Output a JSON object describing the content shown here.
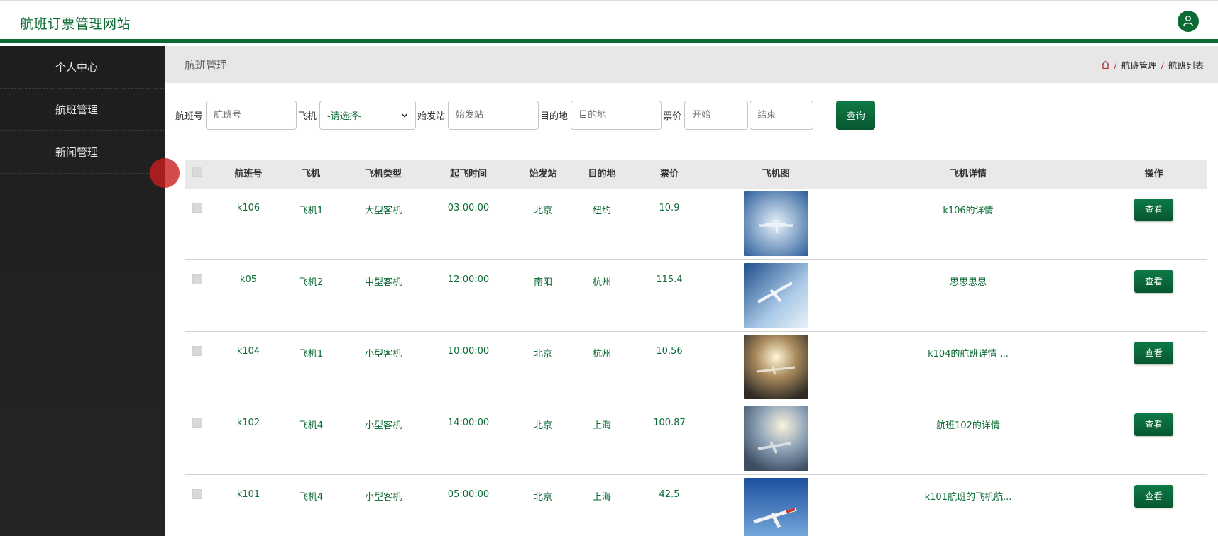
{
  "app": {
    "title": "航班订票管理网站"
  },
  "sidebar": {
    "items": [
      {
        "label": "个人中心"
      },
      {
        "label": "航班管理"
      },
      {
        "label": "新闻管理"
      }
    ]
  },
  "header": {
    "title": "航班管理",
    "breadcrumb": [
      "航班管理",
      "航班列表"
    ]
  },
  "search": {
    "flight_no_label": "航班号",
    "flight_no_placeholder": "航班号",
    "plane_label": "飞机",
    "plane_selected": "-请选择-",
    "origin_label": "始发站",
    "origin_placeholder": "始发站",
    "dest_label": "目的地",
    "dest_placeholder": "目的地",
    "price_label": "票价",
    "price_start_placeholder": "开始",
    "price_end_placeholder": "结束",
    "button": "查询"
  },
  "table": {
    "headers": [
      "航班号",
      "飞机",
      "飞机类型",
      "起飞时间",
      "始发站",
      "目的地",
      "票价",
      "飞机图",
      "飞机详情",
      "操作"
    ],
    "rows": [
      {
        "flight_no": "k106",
        "plane": "飞机1",
        "type": "大型客机",
        "time": "03:00:00",
        "origin": "北京",
        "dest": "纽约",
        "price": "10.9",
        "detail": "k106的详情",
        "action": "查看"
      },
      {
        "flight_no": "k05",
        "plane": "飞机2",
        "type": "中型客机",
        "time": "12:00:00",
        "origin": "南阳",
        "dest": "杭州",
        "price": "115.4",
        "detail": "思思思思",
        "action": "查看"
      },
      {
        "flight_no": "k104",
        "plane": "飞机1",
        "type": "小型客机",
        "time": "10:00:00",
        "origin": "北京",
        "dest": "杭州",
        "price": "10.56",
        "detail": "k104的航班详情 ...",
        "action": "查看"
      },
      {
        "flight_no": "k102",
        "plane": "飞机4",
        "type": "小型客机",
        "time": "14:00:00",
        "origin": "北京",
        "dest": "上海",
        "price": "100.87",
        "detail": "航班102的详情",
        "action": "查看"
      },
      {
        "flight_no": "k101",
        "plane": "飞机4",
        "type": "小型客机",
        "time": "05:00:00",
        "origin": "北京",
        "dest": "上海",
        "price": "42.5",
        "detail": "k101航班的飞机航...",
        "action": "查看"
      }
    ]
  },
  "colors": {
    "accent": "#0b6b35",
    "sidebar": "#1e1e1e",
    "header_bg": "#e7e7e7"
  },
  "icons": {
    "avatar": "user-icon",
    "breadcrumb_home": "home-icon",
    "select_arrow": "chevron-down-icon"
  }
}
